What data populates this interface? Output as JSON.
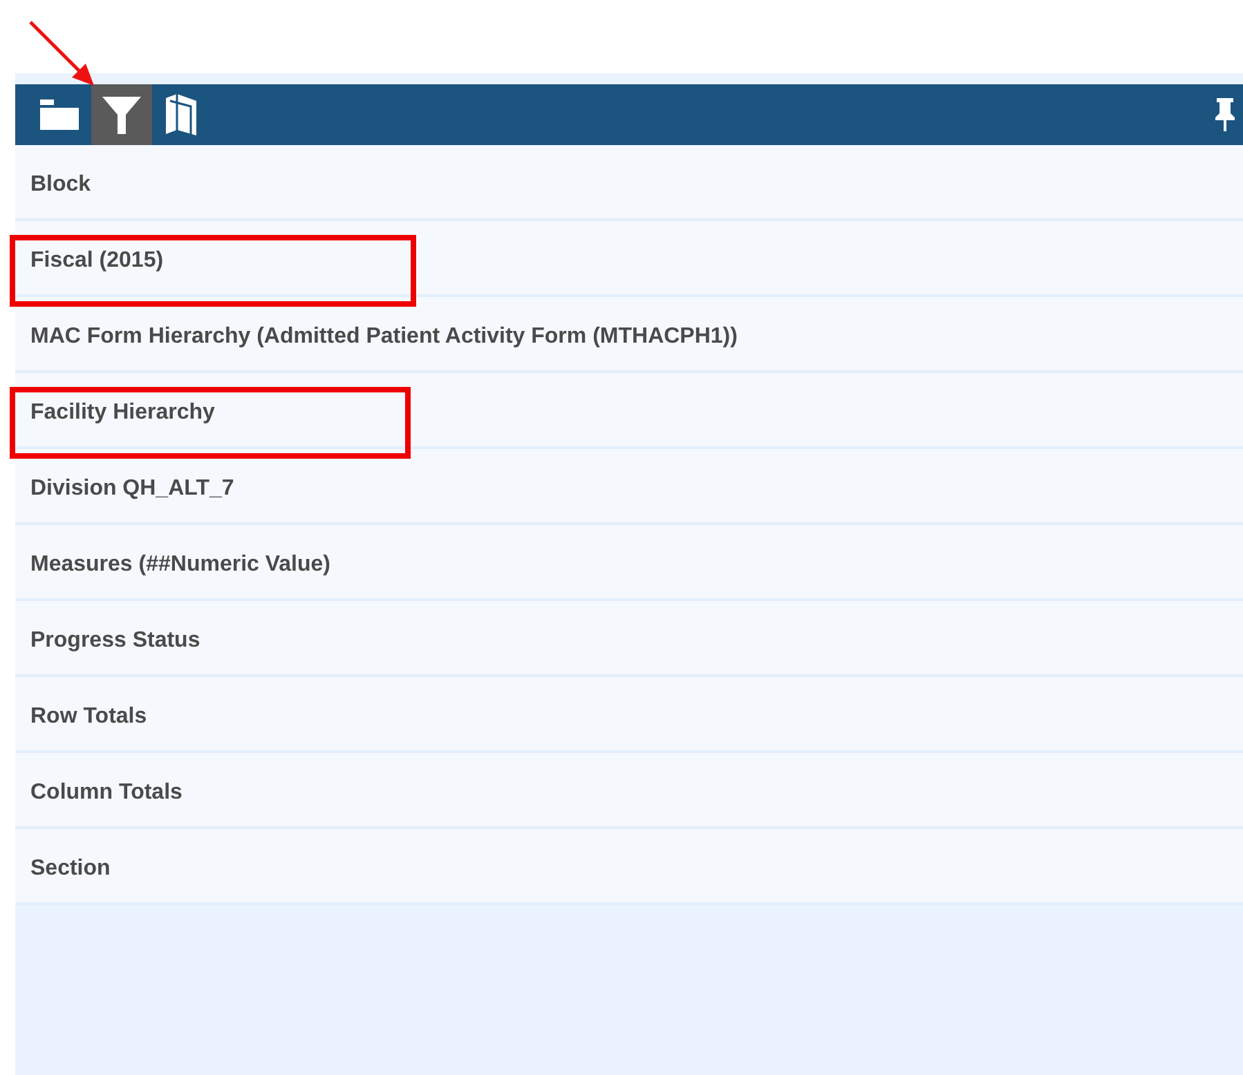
{
  "toolbar": {
    "items": [
      {
        "kind": "folder",
        "selected": false,
        "pointed": false
      },
      {
        "kind": "filter",
        "selected": true,
        "pointed": true
      },
      {
        "kind": "book",
        "selected": false,
        "pointed": false
      }
    ],
    "pin": {
      "kind": "pin"
    }
  },
  "list": {
    "items": [
      {
        "label": "Block",
        "highlighted": false
      },
      {
        "label": "Fiscal (2015)",
        "highlighted": true
      },
      {
        "label": "MAC Form Hierarchy (Admitted Patient Activity Form (MTHACPH1))",
        "highlighted": false
      },
      {
        "label": "Facility Hierarchy",
        "highlighted": true
      },
      {
        "label": "Division QH_ALT_7",
        "highlighted": false
      },
      {
        "label": "Measures (##Numeric Value)",
        "highlighted": false
      },
      {
        "label": "Progress Status",
        "highlighted": false
      },
      {
        "label": "Row Totals",
        "highlighted": false
      },
      {
        "label": "Column Totals",
        "highlighted": false
      },
      {
        "label": "Section",
        "highlighted": false
      }
    ]
  }
}
